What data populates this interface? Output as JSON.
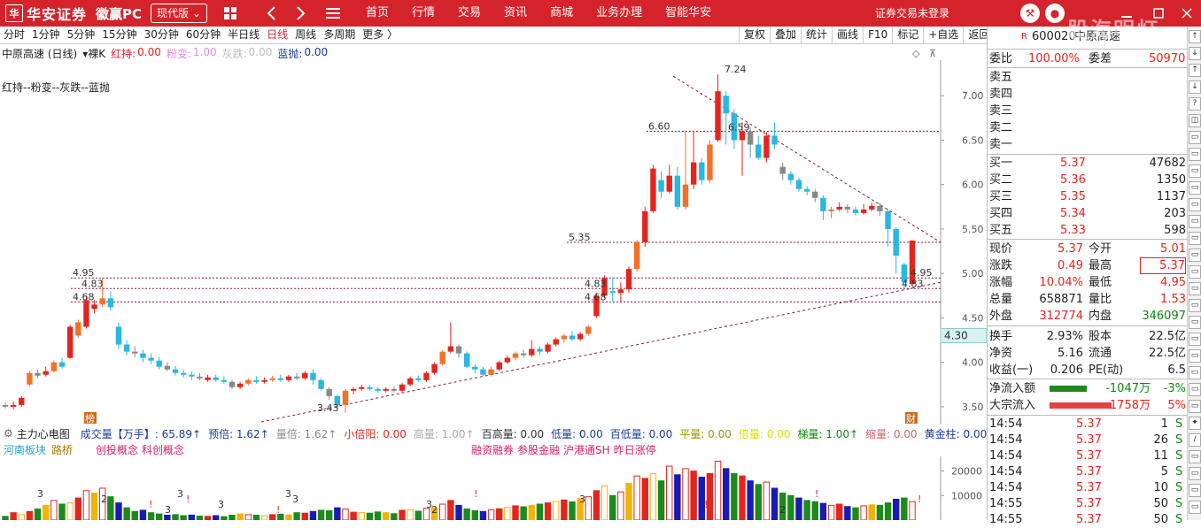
{
  "topbar": {
    "logo_mark": "华",
    "brand": "华安证券",
    "product": "徽赢PC",
    "version_label": "现代版",
    "nav": [
      "首页",
      "行情",
      "交易",
      "资讯",
      "商城",
      "业务办理",
      "智能华安"
    ],
    "login_status": "证券交易未登录",
    "watermark": "股海明灯",
    "colors": {
      "bar": "#d4232b"
    }
  },
  "periods": {
    "items": [
      "分时",
      "1分钟",
      "5分钟",
      "15分钟",
      "30分钟",
      "60分钟",
      "半日线",
      "日线",
      "周线",
      "多周期",
      "更多 〉"
    ],
    "active": "日线"
  },
  "toolbar": [
    "复权",
    "叠加",
    "统计",
    "画线",
    "F10",
    "标记",
    "+自选",
    "返回"
  ],
  "info": {
    "stock": "中原高速 (日线)",
    "kline_type": "裸K",
    "hongchi_label": "红持:",
    "hongchi_value": "0.00",
    "fenbian_label": "粉变:",
    "fenbian_value": "1.00",
    "huidie_label": "灰跌:",
    "huidie_value": "0.00",
    "lanpao_label": "蓝抛:",
    "lanpao_value": "0.00",
    "legend": "红持--粉变--灰跌--蓝抛"
  },
  "chart_data": {
    "type": "candlestick",
    "y_ticks": [
      "7.00",
      "6.50",
      "6.00",
      "5.50",
      "5.00",
      "4.50",
      "4.00",
      "3.50"
    ],
    "ylim": [
      3.3,
      7.4
    ],
    "current_price_tag": "4.30",
    "current_price_value": 4.3,
    "annotations": [
      {
        "text": "4.95",
        "price": 4.95
      },
      {
        "text": "4.83",
        "price": 4.83
      },
      {
        "text": "4.68",
        "price": 4.68
      },
      {
        "text": "5.35",
        "price": 5.35
      },
      {
        "text": "6.60",
        "price": 6.6
      },
      {
        "text": "7.24",
        "price": 7.24
      },
      {
        "text": "6.59",
        "price": 6.59
      },
      {
        "text": "4.95",
        "price": 4.95
      },
      {
        "text": "4.83",
        "price": 4.83
      },
      {
        "text": "4.83",
        "price": 4.83
      },
      {
        "text": "4.68",
        "price": 4.68
      },
      {
        "text": "3.43",
        "price": 3.43
      }
    ],
    "markers": [
      "榜",
      "财"
    ],
    "candles": [
      [
        3.52,
        3.5,
        3.55,
        3.48
      ],
      [
        3.5,
        3.52,
        3.56,
        3.47
      ],
      [
        3.52,
        3.6,
        3.62,
        3.5
      ],
      [
        3.75,
        3.88,
        3.9,
        3.73
      ],
      [
        3.88,
        3.85,
        3.92,
        3.82
      ],
      [
        3.86,
        3.9,
        3.95,
        3.84
      ],
      [
        3.9,
        4.0,
        4.02,
        3.88
      ],
      [
        4.0,
        3.95,
        4.05,
        3.93
      ],
      [
        4.05,
        4.4,
        4.42,
        4.04
      ],
      [
        4.3,
        4.45,
        4.48,
        4.28
      ],
      [
        4.4,
        4.7,
        4.75,
        4.38
      ],
      [
        4.6,
        4.65,
        4.7,
        4.55
      ],
      [
        4.65,
        4.72,
        4.95,
        4.62
      ],
      [
        4.72,
        4.62,
        4.8,
        4.58
      ],
      [
        4.4,
        4.2,
        4.45,
        4.15
      ],
      [
        4.2,
        4.12,
        4.25,
        4.08
      ],
      [
        4.12,
        4.1,
        4.18,
        4.06
      ],
      [
        4.1,
        4.05,
        4.14,
        4.0
      ],
      [
        4.05,
        4.02,
        4.1,
        3.98
      ],
      [
        4.02,
        3.95,
        4.06,
        3.92
      ],
      [
        3.96,
        3.92,
        4.0,
        3.9
      ],
      [
        3.92,
        3.88,
        3.96,
        3.85
      ],
      [
        3.88,
        3.86,
        3.92,
        3.83
      ],
      [
        3.86,
        3.84,
        3.9,
        3.8
      ],
      [
        3.84,
        3.82,
        3.88,
        3.8
      ],
      [
        3.8,
        3.83,
        3.86,
        3.78
      ],
      [
        3.83,
        3.8,
        3.86,
        3.78
      ],
      [
        3.8,
        3.78,
        3.84,
        3.76
      ],
      [
        3.78,
        3.72,
        3.8,
        3.7
      ],
      [
        3.72,
        3.76,
        3.78,
        3.7
      ],
      [
        3.76,
        3.8,
        3.82,
        3.74
      ],
      [
        3.8,
        3.78,
        3.84,
        3.76
      ],
      [
        3.78,
        3.8,
        3.83,
        3.76
      ],
      [
        3.8,
        3.82,
        3.85,
        3.78
      ],
      [
        3.82,
        3.8,
        3.86,
        3.78
      ],
      [
        3.8,
        3.84,
        3.86,
        3.78
      ],
      [
        3.84,
        3.82,
        3.88,
        3.8
      ],
      [
        3.82,
        3.88,
        3.9,
        3.8
      ],
      [
        3.88,
        3.8,
        3.92,
        3.75
      ],
      [
        3.8,
        3.7,
        3.82,
        3.68
      ],
      [
        3.7,
        3.62,
        3.72,
        3.58
      ],
      [
        3.62,
        3.52,
        3.64,
        3.48
      ],
      [
        3.52,
        3.68,
        3.7,
        3.43
      ],
      [
        3.68,
        3.7,
        3.72,
        3.64
      ],
      [
        3.7,
        3.72,
        3.75,
        3.68
      ],
      [
        3.72,
        3.7,
        3.74,
        3.68
      ],
      [
        3.7,
        3.68,
        3.72,
        3.66
      ],
      [
        3.68,
        3.7,
        3.72,
        3.66
      ],
      [
        3.7,
        3.68,
        3.73,
        3.66
      ],
      [
        3.68,
        3.75,
        3.77,
        3.66
      ],
      [
        3.75,
        3.82,
        3.84,
        3.73
      ],
      [
        3.82,
        3.8,
        3.85,
        3.78
      ],
      [
        3.8,
        3.88,
        3.9,
        3.78
      ],
      [
        3.88,
        3.98,
        4.0,
        3.86
      ],
      [
        3.98,
        4.12,
        4.14,
        3.96
      ],
      [
        4.12,
        4.18,
        4.45,
        4.1
      ],
      [
        4.18,
        4.1,
        4.2,
        4.05
      ],
      [
        4.1,
        3.95,
        4.12,
        3.93
      ],
      [
        3.95,
        3.92,
        3.98,
        3.88
      ],
      [
        3.92,
        3.86,
        3.95,
        3.84
      ],
      [
        3.86,
        3.92,
        3.95,
        3.84
      ],
      [
        3.92,
        4.0,
        4.02,
        3.9
      ],
      [
        4.0,
        4.05,
        4.08,
        3.98
      ],
      [
        4.05,
        4.1,
        4.12,
        4.02
      ],
      [
        4.1,
        4.08,
        4.14,
        4.05
      ],
      [
        4.08,
        4.15,
        4.25,
        4.06
      ],
      [
        4.15,
        4.12,
        4.18,
        4.08
      ],
      [
        4.12,
        4.2,
        4.22,
        4.1
      ],
      [
        4.2,
        4.26,
        4.28,
        4.18
      ],
      [
        4.26,
        4.3,
        4.32,
        4.22
      ],
      [
        4.3,
        4.26,
        4.35,
        4.24
      ],
      [
        4.26,
        4.32,
        4.34,
        4.24
      ],
      [
        4.32,
        4.4,
        4.42,
        4.3
      ],
      [
        4.52,
        4.75,
        4.78,
        4.5
      ],
      [
        4.75,
        4.95,
        4.98,
        4.72
      ],
      [
        4.8,
        4.78,
        4.95,
        4.68
      ],
      [
        4.78,
        4.82,
        4.9,
        4.68
      ],
      [
        4.82,
        5.05,
        5.08,
        4.78
      ],
      [
        5.05,
        5.35,
        5.38,
        5.02
      ],
      [
        5.35,
        5.7,
        5.75,
        5.3
      ],
      [
        5.7,
        6.18,
        6.22,
        5.68
      ],
      [
        6.05,
        5.92,
        6.15,
        5.85
      ],
      [
        5.92,
        6.1,
        6.22,
        5.9
      ],
      [
        6.1,
        5.75,
        6.2,
        5.72
      ],
      [
        5.75,
        6.0,
        6.6,
        5.72
      ],
      [
        6.0,
        6.25,
        6.6,
        5.95
      ],
      [
        6.25,
        6.05,
        6.3,
        6.0
      ],
      [
        6.05,
        6.45,
        6.5,
        6.02
      ],
      [
        6.5,
        7.05,
        7.24,
        6.48
      ],
      [
        7.0,
        6.8,
        7.05,
        6.45
      ],
      [
        6.8,
        6.5,
        6.85,
        6.4
      ],
      [
        6.5,
        6.6,
        6.7,
        6.1
      ],
      [
        6.6,
        6.45,
        6.65,
        6.3
      ],
      [
        6.45,
        6.3,
        6.55,
        6.28
      ],
      [
        6.3,
        6.55,
        6.59,
        6.25
      ],
      [
        6.55,
        6.45,
        6.7,
        6.4
      ],
      [
        6.2,
        6.12,
        6.25,
        6.05
      ],
      [
        6.12,
        6.05,
        6.15,
        6.0
      ],
      [
        6.05,
        5.95,
        6.08,
        5.92
      ],
      [
        5.95,
        5.92,
        5.98,
        5.88
      ],
      [
        5.92,
        5.85,
        5.95,
        5.8
      ],
      [
        5.85,
        5.7,
        5.88,
        5.6
      ],
      [
        5.7,
        5.72,
        5.75,
        5.62
      ],
      [
        5.72,
        5.75,
        5.8,
        5.7
      ],
      [
        5.75,
        5.72,
        5.78,
        5.68
      ],
      [
        5.72,
        5.68,
        5.75,
        5.65
      ],
      [
        5.68,
        5.72,
        5.78,
        5.66
      ],
      [
        5.72,
        5.76,
        5.8,
        5.7
      ],
      [
        5.76,
        5.7,
        5.8,
        5.65
      ],
      [
        5.7,
        5.5,
        5.72,
        5.3
      ],
      [
        5.5,
        5.2,
        5.52,
        5.0
      ],
      [
        5.1,
        4.9,
        5.12,
        4.83
      ],
      [
        4.88,
        5.37,
        5.37,
        4.88
      ]
    ]
  },
  "indicator": {
    "title": "主力心电图",
    "items": [
      {
        "label": "成交量【万手】: 65.89↑",
        "color": "#1a3d99"
      },
      {
        "label": "预倍: 1.62↑",
        "color": "#1a3d99"
      },
      {
        "label": "量倍: 1.62↑",
        "color": "#888888"
      },
      {
        "label": "小倍阳: 0.00",
        "color": "#e3251e"
      },
      {
        "label": "高量: 1.00↑",
        "color": "#aaaaaa"
      },
      {
        "label": "百高量: 0.00",
        "color": "#333333"
      },
      {
        "label": "低量: 0.00",
        "color": "#1a3d99"
      },
      {
        "label": "百低量: 0.00",
        "color": "#1a3d99"
      },
      {
        "label": "平量: 0.00",
        "color": "#999900"
      },
      {
        "label": "倍量: 0.00",
        "color": "#dddd00"
      },
      {
        "label": "梯量: 1.00↑",
        "color": "#0a8a0a"
      },
      {
        "label": "缩量: 0.00",
        "color": "#cc6666"
      },
      {
        "label": "黄金柱: 0.00",
        "color": "#1a3d99"
      }
    ]
  },
  "concepts": {
    "left": [
      "河南板块",
      "路桥"
    ],
    "mid": [
      "创投概念",
      "科创概念"
    ],
    "right": [
      "融资融券",
      "参股金融",
      "沪港通SH",
      "昨日涨停"
    ]
  },
  "volume": {
    "y_ticks": [
      "20000",
      "10000"
    ],
    "ylim": [
      0,
      26000
    ],
    "bar_labels": [
      "3",
      "2",
      "!",
      "3",
      "3",
      "!",
      "3",
      "!",
      "3",
      "3",
      "3",
      "2",
      "!",
      "3",
      "!",
      "2",
      "!",
      "!"
    ],
    "values": [
      1500,
      3000,
      2200,
      3500,
      4500,
      6000,
      8000,
      6500,
      7000,
      9000,
      12000,
      11000,
      13000,
      9500,
      7000,
      5000,
      3500,
      4000,
      3000,
      2500,
      2000,
      2200,
      1800,
      2000,
      1600,
      1500,
      1800,
      1400,
      2000,
      2500,
      2200,
      2000,
      1800,
      2200,
      2400,
      2100,
      3000,
      2800,
      3500,
      4000,
      3800,
      5000,
      4500,
      3200,
      3000,
      2800,
      3300,
      3000,
      2600,
      4000,
      4200,
      3600,
      4800,
      5000,
      6500,
      8000,
      6000,
      4500,
      3800,
      3500,
      4200,
      4600,
      5200,
      5800,
      5400,
      6000,
      6500,
      7000,
      7600,
      8200,
      7400,
      8800,
      9500,
      12000,
      14000,
      10000,
      11500,
      15000,
      18000,
      17000,
      19000,
      16000,
      22000,
      18500,
      21000,
      20000,
      17500,
      19000,
      24000,
      21000,
      19000,
      18000,
      16000,
      14500,
      15500,
      13000,
      11000,
      10000,
      9000,
      8000,
      7500,
      6800,
      6000,
      6500,
      5500,
      5000,
      5800,
      6200,
      6000,
      7000,
      8500,
      9000,
      7500
    ]
  },
  "rightpanel": {
    "code_prefix": "R",
    "code": "600020",
    "name": "中原高速",
    "weibi_label": "委比",
    "weibi_value": "100.00%",
    "weicha_label": "委差",
    "weicha_value": "50970",
    "sells": [
      "卖五",
      "卖四",
      "卖三",
      "卖二",
      "卖一"
    ],
    "buys": [
      {
        "label": "买一",
        "price": "5.37",
        "vol": "47682"
      },
      {
        "label": "买二",
        "price": "5.36",
        "vol": "1350"
      },
      {
        "label": "买三",
        "price": "5.35",
        "vol": "1137"
      },
      {
        "label": "买四",
        "price": "5.34",
        "vol": "203"
      },
      {
        "label": "买五",
        "price": "5.33",
        "vol": "598"
      }
    ],
    "stats": [
      {
        "l1": "现价",
        "v1": "5.37",
        "c1": "red",
        "l2": "今开",
        "v2": "5.01",
        "c2": "red"
      },
      {
        "l1": "涨跌",
        "v1": "0.49",
        "c1": "red",
        "l2": "最高",
        "v2": "5.37",
        "c2": "red"
      },
      {
        "l1": "涨幅",
        "v1": "10.04%",
        "c1": "red",
        "l2": "最低",
        "v2": "4.95",
        "c2": "red"
      },
      {
        "l1": "总量",
        "v1": "658871",
        "c1": "",
        "l2": "量比",
        "v2": "1.53",
        "c2": "red"
      },
      {
        "l1": "外盘",
        "v1": "312774",
        "c1": "red",
        "l2": "内盘",
        "v2": "346097",
        "c2": "green"
      },
      {
        "l1": "换手",
        "v1": "2.93%",
        "c1": "",
        "l2": "股本",
        "v2": "22.5亿",
        "c2": ""
      },
      {
        "l1": "净资",
        "v1": "5.16",
        "c1": "",
        "l2": "流通",
        "v2": "22.5亿",
        "c2": ""
      },
      {
        "l1": "收益(一)",
        "v1": "0.206",
        "c1": "",
        "l2": "PE(动)",
        "v2": "6.5",
        "c2": ""
      }
    ],
    "netflow": {
      "label": "净流入额",
      "value": "-1047万",
      "pct": "-3%"
    },
    "bigflow": {
      "label": "大宗流入",
      "value": "1758万",
      "pct": "5%"
    },
    "ticks": [
      {
        "time": "14:54",
        "price": "5.37",
        "vol": "1",
        "side": "S"
      },
      {
        "time": "14:54",
        "price": "5.37",
        "vol": "26",
        "side": "S"
      },
      {
        "time": "14:54",
        "price": "5.37",
        "vol": "11",
        "side": "S"
      },
      {
        "time": "14:54",
        "price": "5.37",
        "vol": "5",
        "side": "S"
      },
      {
        "time": "14:54",
        "price": "5.37",
        "vol": "10",
        "side": "S"
      },
      {
        "time": "14:55",
        "price": "5.37",
        "vol": "50",
        "side": "S"
      },
      {
        "time": "14:55",
        "price": "5.37",
        "vol": "50",
        "side": "S"
      }
    ]
  }
}
